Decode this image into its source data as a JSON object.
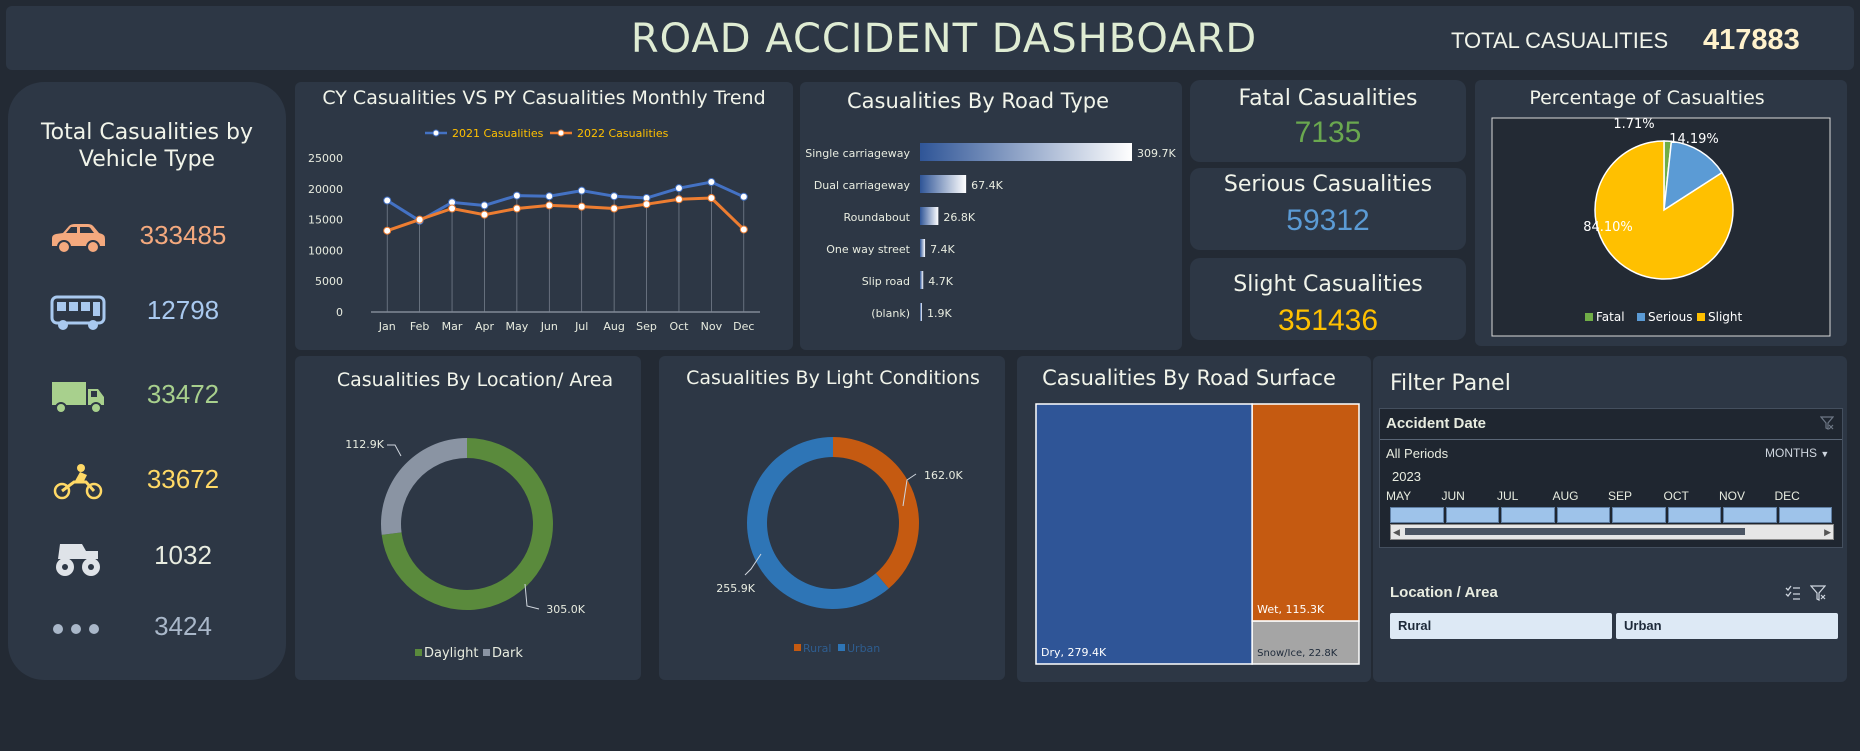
{
  "header": {
    "title": "ROAD ACCIDENT DASHBOARD",
    "total_label": "TOTAL CASUALITIES",
    "total_value": "417883"
  },
  "vehicle": {
    "title_line1": "Total Casualities by",
    "title_line2": "Vehicle Type",
    "items": [
      {
        "icon": "car-icon",
        "value": "333485",
        "color": "#f4a97e"
      },
      {
        "icon": "bus-icon",
        "value": "12798",
        "color": "#a9c9ef"
      },
      {
        "icon": "truck-icon",
        "value": "33472",
        "color": "#a8d08d"
      },
      {
        "icon": "motorcycle-icon",
        "value": "33672",
        "color": "#ffd966"
      },
      {
        "icon": "monster-truck-icon",
        "value": "1032",
        "color": "#e8ece0"
      },
      {
        "icon": "more-dots-icon",
        "value": "3424",
        "color": "#a9b7c9"
      }
    ]
  },
  "kpis": {
    "fatal_label": "Fatal Casualities",
    "fatal_value": "7135",
    "serious_label": "Serious Casualities",
    "serious_value": "59312",
    "slight_label": "Slight Casualities",
    "slight_value": "351436"
  },
  "filter": {
    "title": "Filter Panel",
    "date_title": "Accident Date",
    "all_periods": "All Periods",
    "months_label": "MONTHS",
    "year": "2023",
    "months": [
      "MAY",
      "JUN",
      "JUL",
      "AUG",
      "SEP",
      "OCT",
      "NOV",
      "DEC"
    ],
    "location_title": "Location / Area",
    "options": [
      "Rural",
      "Urban"
    ]
  },
  "chart_data": [
    {
      "id": "monthly_trend",
      "type": "line",
      "title": "CY Casualities VS PY Casualities Monthly Trend",
      "categories": [
        "Jan",
        "Feb",
        "Mar",
        "Apr",
        "May",
        "Jun",
        "Jul",
        "Aug",
        "Sep",
        "Oct",
        "Nov",
        "Dec"
      ],
      "series": [
        {
          "name": "2021 Casualities",
          "color": "#4472c4",
          "values": [
            18100,
            14800,
            17800,
            17300,
            18900,
            18800,
            19700,
            18800,
            18500,
            20100,
            21100,
            18700
          ]
        },
        {
          "name": "2022 Casualities",
          "color": "#ed7d31",
          "values": [
            13200,
            15000,
            16800,
            15800,
            16800,
            17300,
            17100,
            16800,
            17500,
            18300,
            18500,
            13400
          ]
        }
      ],
      "ylim": [
        0,
        25000
      ],
      "yticks": [
        0,
        5000,
        10000,
        15000,
        20000,
        25000
      ],
      "legend": "top"
    },
    {
      "id": "road_type",
      "type": "bar",
      "title": "Casualities By Road Type",
      "categories": [
        "Single carriageway",
        "Dual carriageway",
        "Roundabout",
        "One way street",
        "Slip road",
        "(blank)"
      ],
      "values": [
        309.7,
        67.4,
        26.8,
        7.4,
        4.7,
        1.9
      ],
      "labels": [
        "309.7K",
        "67.4K",
        "26.8K",
        "7.4K",
        "4.7K",
        "1.9K"
      ]
    },
    {
      "id": "severity_pct",
      "type": "pie",
      "title": "Percentage of Casualties",
      "categories": [
        "Fatal",
        "Serious",
        "Slight"
      ],
      "values": [
        1.71,
        14.19,
        84.1
      ],
      "labels": [
        "1.71%",
        "14.19%",
        "84.10%"
      ],
      "colors": [
        "#70ad47",
        "#5b9bd5",
        "#ffc000"
      ],
      "legend": "bottom"
    },
    {
      "id": "location",
      "type": "pie",
      "title": "Casualities By Location/ Area",
      "categories": [
        "Daylight",
        "Dark"
      ],
      "values": [
        305.0,
        112.9
      ],
      "labels": [
        "305.0K",
        "112.9K"
      ],
      "colors": [
        "#5a8a3c",
        "#8a94a3"
      ],
      "legend": "bottom"
    },
    {
      "id": "light",
      "type": "pie",
      "title": "Casualities By Light Conditions",
      "categories": [
        "Rural",
        "Urban"
      ],
      "values": [
        162.0,
        255.9
      ],
      "labels": [
        "162.0K",
        "255.9K"
      ],
      "colors": [
        "#c55a11",
        "#2e75b6"
      ],
      "legend": "bottom"
    },
    {
      "id": "surface",
      "type": "treemap",
      "title": "Casualities By Road Surface",
      "categories": [
        "Dry",
        "Wet",
        "Snow/Ice"
      ],
      "values": [
        279.4,
        115.3,
        22.8
      ],
      "labels": [
        "Dry, 279.4K",
        "Wet, 115.3K",
        "Snow/Ice, 22.8K"
      ],
      "colors": [
        "#2f5597",
        "#c55a11",
        "#a5a5a5"
      ]
    }
  ]
}
